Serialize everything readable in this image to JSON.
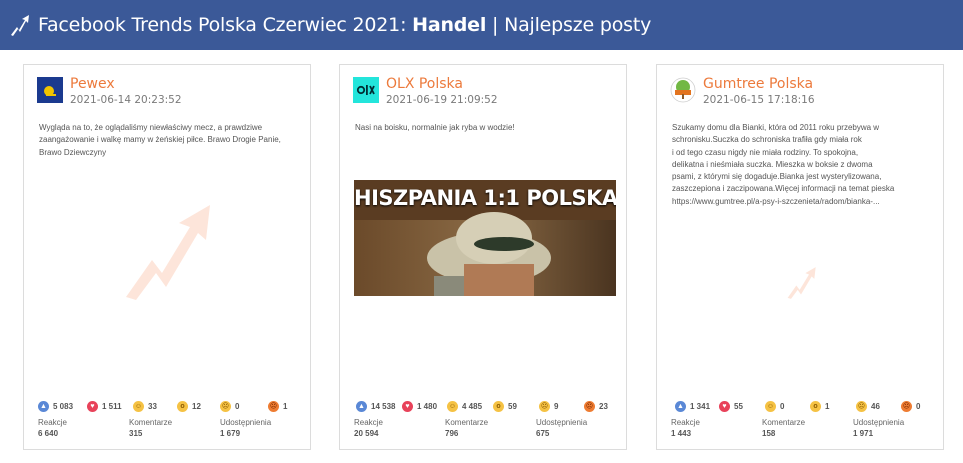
{
  "header": {
    "title_prefix": "Facebook Trends Polska Czerwiec 2021: ",
    "title_bold": "Handel",
    "title_suffix": " | Najlepsze posty"
  },
  "colors": {
    "header_bg": "#3b5998",
    "name_accent": "#ec7a3c"
  },
  "posts": [
    {
      "page_name": "Pewex",
      "date": "2021-06-14 20:23:52",
      "text": "Wygląda na to, że oglądaliśmy niewłaściwy mecz, a prawdziwe\nzaangażowanie i walkę mamy w żeńskiej piłce. Brawo Drogie Panie,\nBrawo Dziewczyny",
      "reactions": {
        "like": "5 083",
        "love": "1 511",
        "haha": "33",
        "wow": "12",
        "sad": "0",
        "angry": "1"
      },
      "stats": {
        "reakcje_label": "Reakcje",
        "reakcje": "6 640",
        "komentarze_label": "Komentarze",
        "komentarze": "315",
        "udostepnienia_label": "Udostępnienia",
        "udostepnienia": "1 679"
      }
    },
    {
      "page_name": "OLX Polska",
      "date": "2021-06-19 21:09:52",
      "text": "Nasi na boisku, normalnie jak ryba w wodzie!",
      "image_caption": "HISZPANIA 1:1 POLSKA",
      "reactions": {
        "like": "14 538",
        "love": "1 480",
        "haha": "4 485",
        "wow": "59",
        "sad": "9",
        "angry": "23"
      },
      "stats": {
        "reakcje_label": "Reakcje",
        "reakcje": "20 594",
        "komentarze_label": "Komentarze",
        "komentarze": "796",
        "udostepnienia_label": "Udostępnienia",
        "udostepnienia": "675"
      }
    },
    {
      "page_name": "Gumtree Polska",
      "date": "2021-06-15 17:18:16",
      "text": "Szukamy domu dla Bianki, która od 2011 roku przebywa w\nschronisku.Suczka do schroniska trafiła gdy miała rok\ni od tego czasu nigdy nie miała rodziny. To spokojna,\ndelikatna i nieśmiała suczka. Mieszka w boksie z dwoma\npsami, z którymi się dogaduje.Bianka jest wysterylizowana,\nzaszczepiona i zaczipowana.Więcej informacji na temat pieska\nhttps://www.gumtree.pl/a-psy-i-szczenieta/radom/bianka-...",
      "reactions": {
        "like": "1 341",
        "love": "55",
        "haha": "0",
        "wow": "1",
        "sad": "46",
        "angry": "0"
      },
      "stats": {
        "reakcje_label": "Reakcje",
        "reakcje": "1 443",
        "komentarze_label": "Komentarze",
        "komentarze": "158",
        "udostepnienia_label": "Udostępnienia",
        "udostepnienia": "1 971"
      }
    }
  ],
  "icons": [
    "trend-arrow-icon",
    "like-icon",
    "love-icon",
    "haha-icon",
    "wow-icon",
    "sad-icon",
    "angry-icon"
  ]
}
